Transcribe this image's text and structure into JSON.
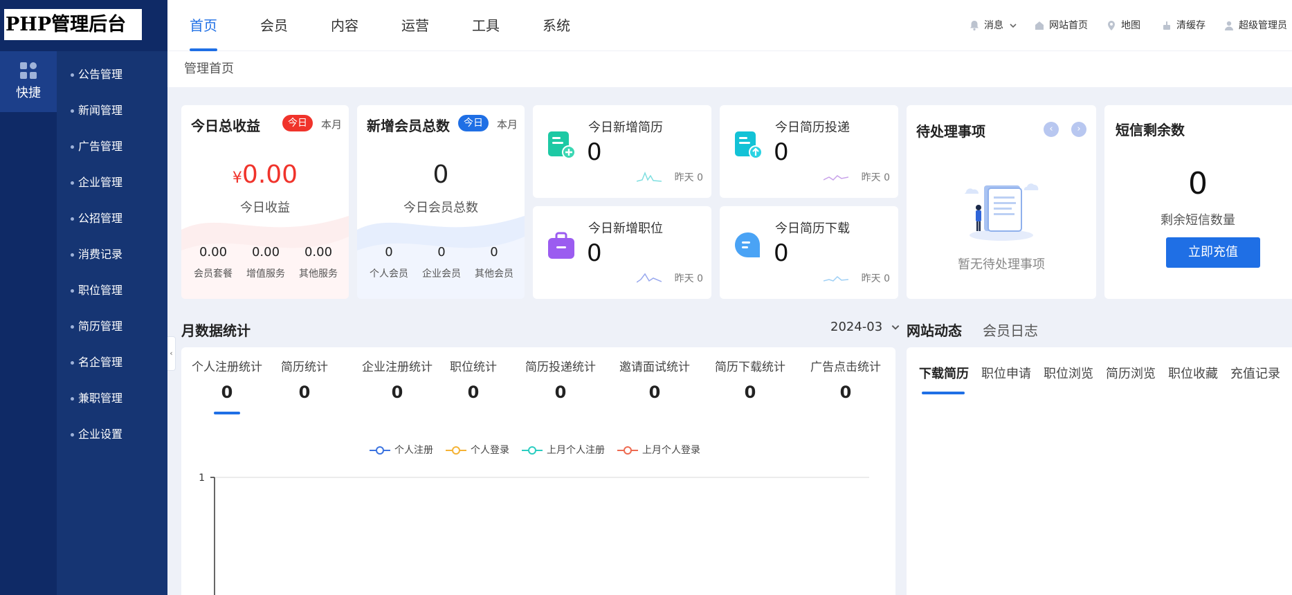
{
  "brand": {
    "logo_text": "PHP管理后台"
  },
  "rail": {
    "item_label": "快捷"
  },
  "submenu": {
    "items": [
      "公告管理",
      "新闻管理",
      "广告管理",
      "企业管理",
      "公招管理",
      "消费记录",
      "职位管理",
      "简历管理",
      "名企管理",
      "兼职管理",
      "企业设置"
    ]
  },
  "topnav": {
    "tabs": [
      "首页",
      "会员",
      "内容",
      "运营",
      "工具",
      "系统"
    ],
    "tools": {
      "messages": "消息",
      "site_home": "网站首页",
      "map": "地图",
      "clear_cache": "清缓存",
      "admin": "超级管理员"
    }
  },
  "breadcrumb": "管理首页",
  "income_card": {
    "title": "今日总收益",
    "today": "今日",
    "month": "本月",
    "currency": "¥",
    "amount": "0.00",
    "caption": "今日收益",
    "stats": [
      {
        "value": "0.00",
        "label": "会员套餐"
      },
      {
        "value": "0.00",
        "label": "增值服务"
      },
      {
        "value": "0.00",
        "label": "其他服务"
      }
    ]
  },
  "members_card": {
    "title": "新增会员总数",
    "today": "今日",
    "month": "本月",
    "amount": "0",
    "caption": "今日会员总数",
    "stats": [
      {
        "value": "0",
        "label": "个人会员"
      },
      {
        "value": "0",
        "label": "企业会员"
      },
      {
        "value": "0",
        "label": "其他会员"
      }
    ]
  },
  "mini_cards": [
    {
      "label": "今日新增简历",
      "value": "0",
      "yday": "昨天 0"
    },
    {
      "label": "今日简历投递",
      "value": "0",
      "yday": "昨天 0"
    },
    {
      "label": "今日新增职位",
      "value": "0",
      "yday": "昨天 0"
    },
    {
      "label": "今日简历下载",
      "value": "0",
      "yday": "昨天 0"
    }
  ],
  "todo": {
    "title": "待处理事项",
    "empty": "暂无待处理事项"
  },
  "sms": {
    "title": "短信剩余数",
    "amount": "0",
    "caption": "剩余短信数量",
    "button": "立即充值"
  },
  "monthly": {
    "title": "月数据统计",
    "month": "2024-03",
    "tabs": [
      {
        "label": "个人注册统计",
        "value": "0"
      },
      {
        "label": "简历统计",
        "value": "0"
      },
      {
        "label": "企业注册统计",
        "value": "0"
      },
      {
        "label": "职位统计",
        "value": "0"
      },
      {
        "label": "简历投递统计",
        "value": "0"
      },
      {
        "label": "邀请面试统计",
        "value": "0"
      },
      {
        "label": "简历下载统计",
        "value": "0"
      },
      {
        "label": "广告点击统计",
        "value": "0"
      }
    ]
  },
  "chart_data": {
    "type": "line",
    "series": [
      {
        "name": "个人注册",
        "color": "#3b73e0",
        "values": []
      },
      {
        "name": "个人登录",
        "color": "#f5b335",
        "values": []
      },
      {
        "name": "上月个人注册",
        "color": "#2bcdc1",
        "values": []
      },
      {
        "name": "上月个人登录",
        "color": "#ee6a50",
        "values": []
      }
    ],
    "y_ticks": [
      "1"
    ],
    "ylim": [
      0,
      1
    ],
    "grid": true
  },
  "feed": {
    "tabs": [
      "网站动态",
      "会员日志"
    ],
    "subtabs": [
      "下载简历",
      "职位申请",
      "职位浏览",
      "简历浏览",
      "职位收藏",
      "充值记录"
    ]
  },
  "colors": {
    "accent": "#1f6fe5",
    "sidebar": "#0f2a66",
    "submenu": "#163573",
    "danger": "#f0332b"
  }
}
